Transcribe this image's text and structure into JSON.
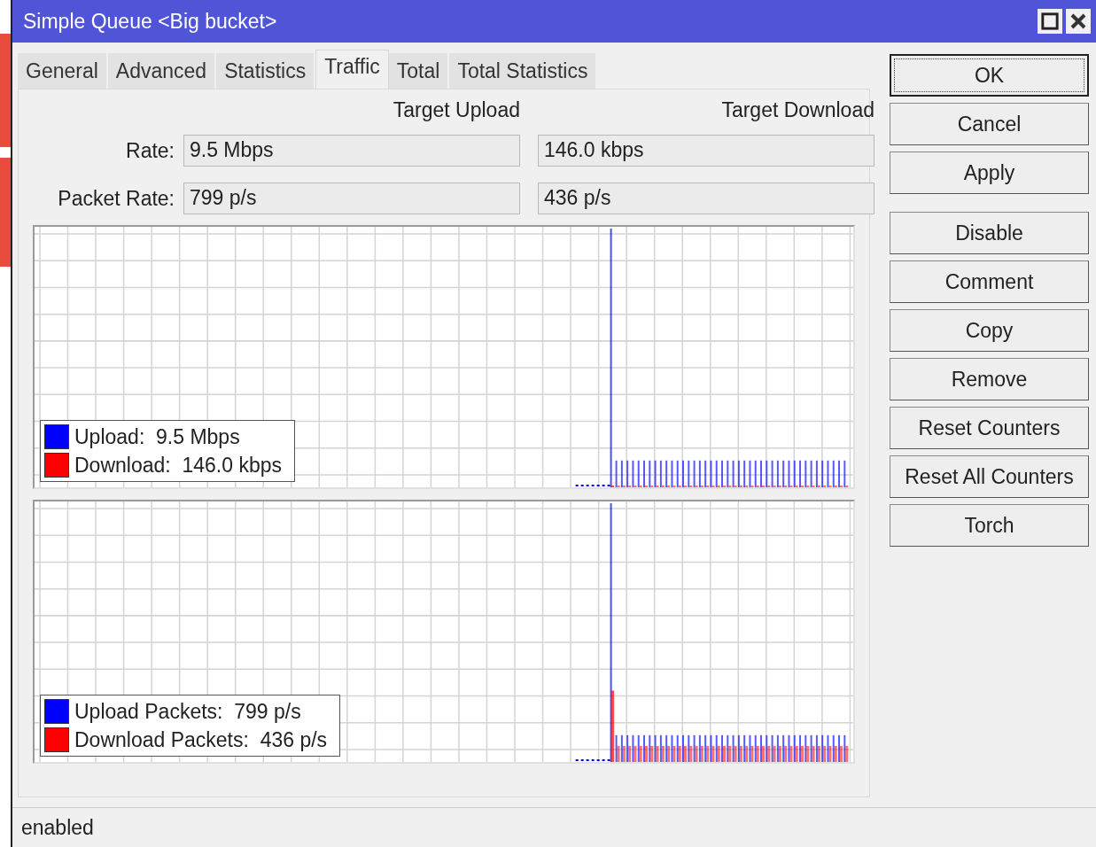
{
  "window": {
    "title": "Simple Queue <Big bucket>"
  },
  "tabs": [
    {
      "label": "General",
      "selected": false
    },
    {
      "label": "Advanced",
      "selected": false
    },
    {
      "label": "Statistics",
      "selected": false
    },
    {
      "label": "Traffic",
      "selected": true
    },
    {
      "label": "Total",
      "selected": false
    },
    {
      "label": "Total Statistics",
      "selected": false
    }
  ],
  "columns": [
    "Target Upload",
    "Target Download"
  ],
  "rows": [
    {
      "label": "Rate:",
      "upload": "9.5 Mbps",
      "download": "146.0 kbps"
    },
    {
      "label": "Packet Rate:",
      "upload": "799 p/s",
      "download": "436 p/s"
    }
  ],
  "graphs": [
    {
      "legend": [
        {
          "label": "Upload:  9.5 Mbps",
          "color": "#0000ff"
        },
        {
          "label": "Download:  146.0 kbps",
          "color": "#ff0000"
        }
      ]
    },
    {
      "legend": [
        {
          "label": "Upload Packets:  799 p/s",
          "color": "#0000ff"
        },
        {
          "label": "Download Packets:  436 p/s",
          "color": "#ff0000"
        }
      ]
    }
  ],
  "buttons": [
    {
      "label": "OK",
      "default": true
    },
    {
      "label": "Cancel",
      "default": false
    },
    {
      "label": "Apply",
      "default": false
    },
    {
      "label": "Disable",
      "default": false
    },
    {
      "label": "Comment",
      "default": false
    },
    {
      "label": "Copy",
      "default": false
    },
    {
      "label": "Remove",
      "default": false
    },
    {
      "label": "Reset Counters",
      "default": false
    },
    {
      "label": "Reset All Counters",
      "default": false
    },
    {
      "label": "Torch",
      "default": false
    }
  ],
  "status_bar": "enabled"
}
